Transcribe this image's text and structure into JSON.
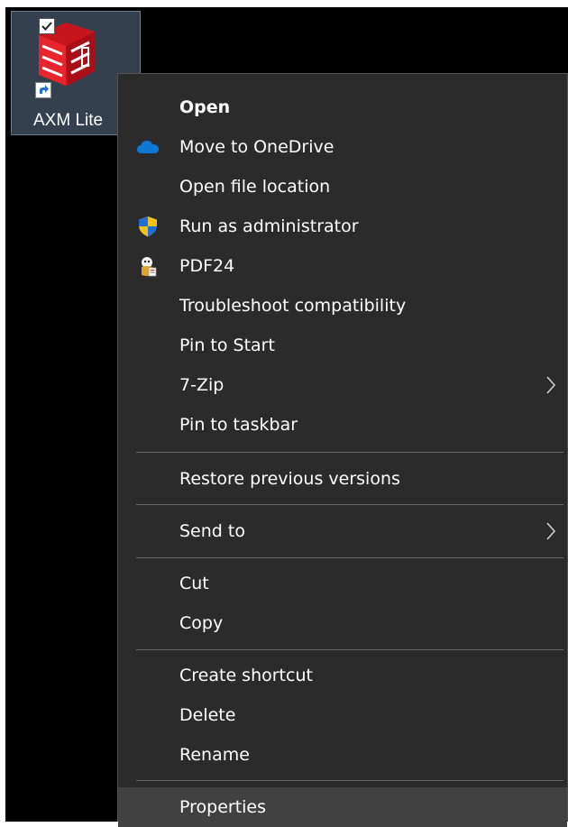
{
  "desktop": {
    "icon_label": "AXM Lite",
    "icon_checked": true
  },
  "context_menu": {
    "items": [
      {
        "label": "Open",
        "bold": true
      },
      {
        "label": "Move to OneDrive",
        "icon": "onedrive-cloud-icon"
      },
      {
        "label": "Open file location"
      },
      {
        "label": "Run as administrator",
        "icon": "uac-shield-icon"
      },
      {
        "label": "PDF24",
        "icon": "pdf24-icon"
      },
      {
        "label": "Troubleshoot compatibility"
      },
      {
        "label": "Pin to Start"
      },
      {
        "label": "7-Zip",
        "submenu": true
      },
      {
        "label": "Pin to taskbar"
      },
      {
        "label": "Restore previous versions"
      },
      {
        "label": "Send to",
        "submenu": true
      },
      {
        "label": "Cut"
      },
      {
        "label": "Copy"
      },
      {
        "label": "Create shortcut"
      },
      {
        "label": "Delete"
      },
      {
        "label": "Rename"
      },
      {
        "label": "Properties",
        "highlighted": true
      }
    ]
  },
  "colors": {
    "menu_background": "#2b2b2b",
    "menu_text": "#ffffff",
    "highlight": "#414141",
    "separator": "#6a6a6a",
    "brand_red": "#e8242c",
    "onedrive_blue": "#0f78d4"
  }
}
